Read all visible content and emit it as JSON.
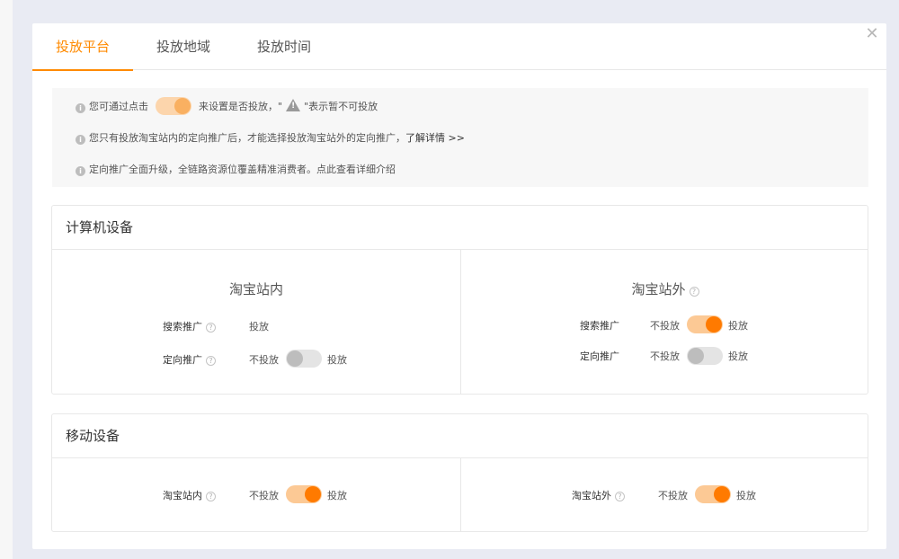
{
  "tabs": [
    {
      "label": "投放平台",
      "active": true
    },
    {
      "label": "投放地域",
      "active": false
    },
    {
      "label": "投放时间",
      "active": false
    }
  ],
  "close_icon": "close-icon",
  "notice": {
    "line1_prefix": "您可通过点击",
    "line1_middle": "来设置是否投放，\"",
    "line1_suffix": "\"表示暂不可投放",
    "line2_text": "您只有投放淘宝站内的定向推广后，才能选择投放淘宝站外的定向推广，",
    "line2_link": "了解详情 >>",
    "line3_text": "定向推广全面升级，全链路资源位覆盖精准消费者。点此查看详细介绍"
  },
  "computer": {
    "title": "计算机设备",
    "inner": {
      "title": "淘宝站内",
      "search_label": "搜索推广",
      "search_value": "投放",
      "targeted_label": "定向推广",
      "targeted_off": "不投放",
      "targeted_on": "投放",
      "targeted_state": "off"
    },
    "outer": {
      "title": "淘宝站外",
      "search_label": "搜索推广",
      "search_off": "不投放",
      "search_on": "投放",
      "search_state": "on",
      "targeted_label": "定向推广",
      "targeted_off": "不投放",
      "targeted_on": "投放",
      "targeted_state": "off"
    }
  },
  "mobile": {
    "title": "移动设备",
    "inner": {
      "label": "淘宝站内",
      "off": "不投放",
      "on": "投放",
      "state": "on"
    },
    "outer": {
      "label": "淘宝站外",
      "off": "不投放",
      "on": "投放",
      "state": "on"
    }
  },
  "colors": {
    "accent": "#ff7a00",
    "toggle_on_track": "#fcc995",
    "toggle_off_track": "#e4e4e4"
  }
}
